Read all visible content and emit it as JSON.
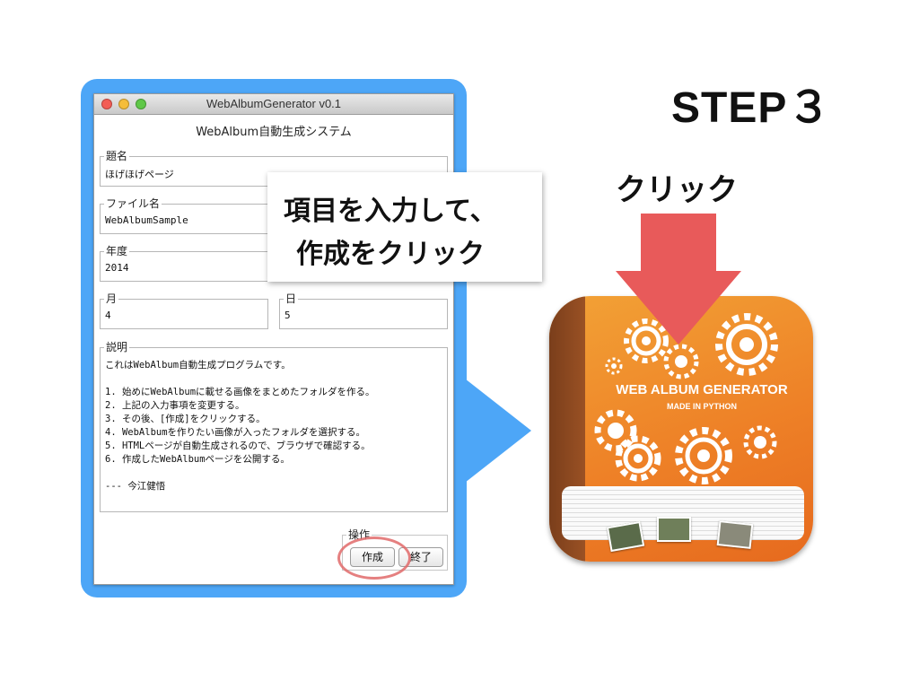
{
  "slide": {
    "step_title": "STEP３",
    "click_label": "クリック",
    "callout_lines": [
      "項目を入力して、",
      "作成をクリック"
    ]
  },
  "window": {
    "title": "WebAlbumGenerator v0.1",
    "heading": "WebAlbum自動生成システム",
    "fields": {
      "title_label": "題名",
      "title_value": "ほげほげページ",
      "filename_label": "ファイル名",
      "filename_value": "WebAlbumSample",
      "year_label": "年度",
      "year_value": "2014",
      "month_label": "月",
      "month_value": "4",
      "day_label": "日",
      "day_value": "5"
    },
    "description": {
      "label": "説明",
      "text": "これはWebAlbum自動生成プログラムです。\n\n1. 始めにWebAlbumに載せる画像をまとめたフォルダを作る。\n2. 上記の入力事項を変更する。\n3. その後、[作成]をクリックする。\n4. WebAlbumを作りたい画像が入ったフォルダを選択する。\n5. HTMLページが自動生成されるので、ブラウザで確認する。\n6. 作成したWebAlbumページを公開する。\n\n--- 今江健悟"
    },
    "actions": {
      "label": "操作",
      "create_button": "作成",
      "exit_button": "終了"
    }
  },
  "app_icon": {
    "title": "WEB ALBUM GENERATOR",
    "subtitle": "MADE IN PYTHON"
  },
  "colors": {
    "frame_blue": "#4da6f7",
    "arrow_red": "#e85a5a",
    "icon_orange": "#ee8127"
  }
}
